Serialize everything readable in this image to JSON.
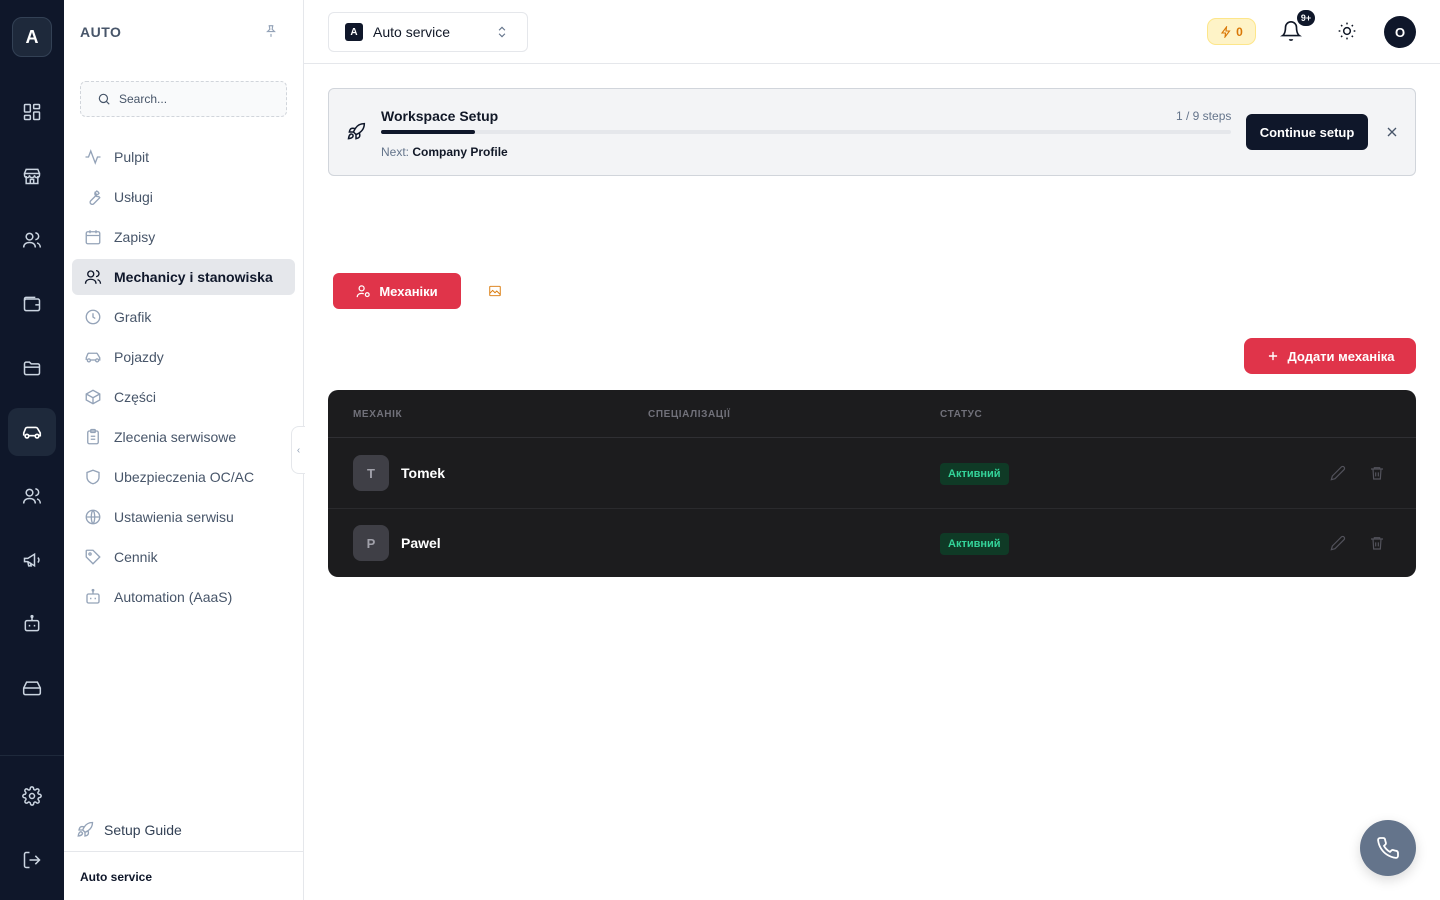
{
  "rail": {
    "logo_letter": "A",
    "items": [
      {
        "icon": "dashboard-icon"
      },
      {
        "icon": "store-icon"
      },
      {
        "icon": "users-icon"
      },
      {
        "icon": "wallet-icon"
      },
      {
        "icon": "folder-icon"
      },
      {
        "icon": "car-icon",
        "active": true
      },
      {
        "icon": "team-icon"
      },
      {
        "icon": "megaphone-icon"
      },
      {
        "icon": "bot-icon"
      },
      {
        "icon": "hard-drive-icon"
      }
    ],
    "bottom": [
      {
        "icon": "settings-icon"
      },
      {
        "icon": "logout-icon"
      }
    ]
  },
  "sidebar": {
    "title": "AUTO",
    "search_placeholder": "Search...",
    "items": [
      {
        "label": "Pulpit",
        "icon": "activity-icon"
      },
      {
        "label": "Usługi",
        "icon": "wrench-icon"
      },
      {
        "label": "Zapisy",
        "icon": "calendar-icon"
      },
      {
        "label": "Mechanicy i stanowiska",
        "icon": "users-icon",
        "active": true
      },
      {
        "label": "Grafik",
        "icon": "clock-icon"
      },
      {
        "label": "Pojazdy",
        "icon": "car-icon"
      },
      {
        "label": "Części",
        "icon": "box-icon"
      },
      {
        "label": "Zlecenia serwisowe",
        "icon": "clipboard-icon"
      },
      {
        "label": "Ubezpieczenia OC/AC",
        "icon": "shield-icon"
      },
      {
        "label": "Ustawienia serwisu",
        "icon": "globe-icon"
      },
      {
        "label": "Cennik",
        "icon": "tag-icon"
      },
      {
        "label": "Automation (AaaS)",
        "icon": "bot-icon"
      }
    ],
    "setup_guide": "Setup Guide",
    "footer": "Auto service"
  },
  "topbar": {
    "workspace_badge": "A",
    "workspace_name": "Auto service",
    "credits": "0",
    "notifications_badge": "9+",
    "avatar_letter": "O"
  },
  "setup": {
    "title": "Workspace Setup",
    "steps": "1 / 9 steps",
    "progress": 0.111,
    "next_label": "Next:",
    "next_value": "Company Profile",
    "cta": "Continue setup"
  },
  "tabs": {
    "mechanics": "Механіки"
  },
  "add_button": "Додати механіка",
  "table": {
    "columns": [
      "МЕХАНІК",
      "СПЕЦІАЛІЗАЦІЇ",
      "СТАТУС"
    ],
    "rows": [
      {
        "initial": "T",
        "name": "Tomek",
        "specializations": "",
        "status": "Активний"
      },
      {
        "initial": "P",
        "name": "Pawel",
        "specializations": "",
        "status": "Активний"
      }
    ]
  },
  "colors": {
    "rail_bg": "#0f172a",
    "accent_red": "#e0344a",
    "table_bg": "#1c1c1e",
    "status_green": "#34d399"
  }
}
